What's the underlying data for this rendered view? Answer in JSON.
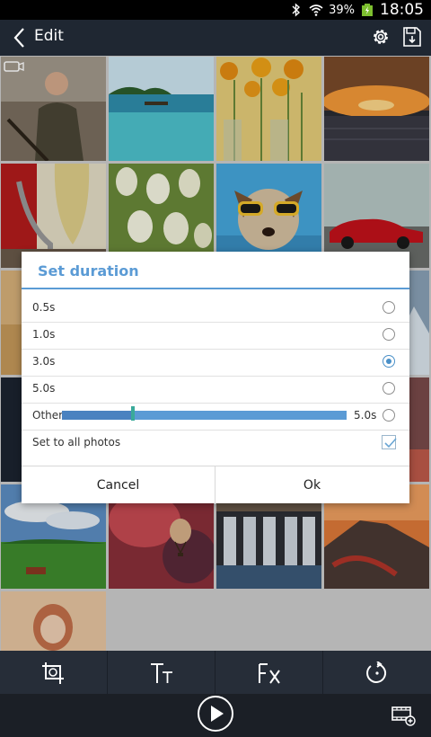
{
  "status": {
    "battery_pct": "39%",
    "time": "18:05"
  },
  "toolbar": {
    "title": "Edit"
  },
  "dialog": {
    "title": "Set duration",
    "options": [
      {
        "label": "0.5s",
        "selected": false
      },
      {
        "label": "1.0s",
        "selected": false
      },
      {
        "label": "3.0s",
        "selected": true
      },
      {
        "label": "5.0s",
        "selected": false
      }
    ],
    "other": {
      "label": "Other",
      "value_text": "5.0s",
      "slider_fraction": 0.25,
      "selected": false
    },
    "set_all": {
      "label": "Set to all photos",
      "checked": true
    },
    "cancel_label": "Cancel",
    "ok_label": "Ok"
  },
  "colors": {
    "accent": "#5b9bd5",
    "toolbar_bg": "#1f2732",
    "bottom_bg": "#262d38"
  }
}
